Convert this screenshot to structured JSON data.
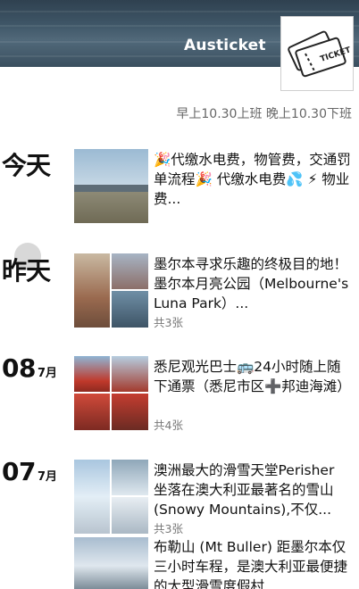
{
  "profile": {
    "name": "Austicket",
    "signature": "早上10.30上班 晚上10.30下班",
    "avatar_icon": "ticket-icon",
    "avatar_text": "TICKET"
  },
  "timeline": [
    {
      "day": "今天",
      "text": "🎉代缴水电费，物管费，交通罚单流程🎉 代缴水电费💦 ⚡ 物业费...",
      "count": ""
    },
    {
      "day": "昨天",
      "text": "墨尔本寻求乐趣的终极目的地！ 墨尔本月亮公园（Melbourne's Luna Park）...",
      "count": "共3张"
    },
    {
      "day_num": "08",
      "month": "7月",
      "text": "悉尼观光巴士🚌24小时随上随下通票（悉尼市区➕邦迪海滩）",
      "count": "共4张"
    },
    {
      "day_num": "07",
      "month": "7月",
      "text": "澳洲最大的滑雪天堂Perisher 坐落在澳大利亚最著名的雪山(Snowy Mountains),不仅...",
      "count": "共3张"
    },
    {
      "text": "布勒山 (Mt Buller) 距墨尔本仅三小时车程，是澳大利亚最便捷的大型滑雪度假村...",
      "count": ""
    }
  ]
}
